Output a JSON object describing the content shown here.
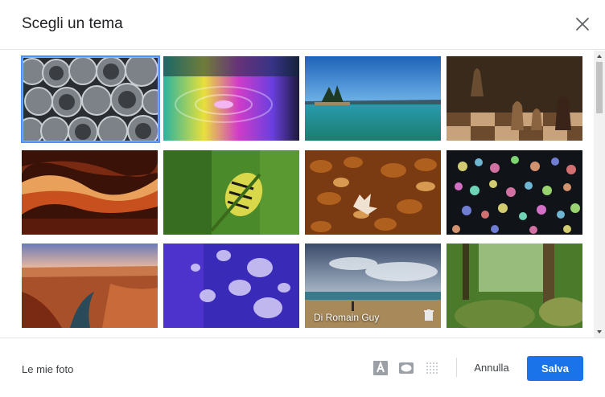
{
  "dialog": {
    "title": "Scegli un tema",
    "close_icon": "close-icon"
  },
  "themes": [
    {
      "name": "steel-pipes",
      "selected": true
    },
    {
      "name": "colorful-water-drop",
      "selected": false
    },
    {
      "name": "lake-islands",
      "selected": false
    },
    {
      "name": "chess-pieces",
      "selected": false
    },
    {
      "name": "canyon-rock-waves",
      "selected": false
    },
    {
      "name": "caterpillar",
      "selected": false
    },
    {
      "name": "autumn-leaves",
      "selected": false
    },
    {
      "name": "colorful-bokeh",
      "selected": false
    },
    {
      "name": "canyon-river",
      "selected": false
    },
    {
      "name": "jellyfish",
      "selected": false
    },
    {
      "name": "beach-clouds",
      "selected": false,
      "credit": "Di Romain Guy"
    },
    {
      "name": "forest",
      "selected": false
    }
  ],
  "footer": {
    "my_photos": "Le mie foto",
    "tools": [
      "text-color-icon",
      "vignette-icon",
      "blur-icon"
    ],
    "cancel_label": "Annulla",
    "save_label": "Salva"
  },
  "colors": {
    "accent": "#1a73e8",
    "selection": "#4d90fe"
  }
}
